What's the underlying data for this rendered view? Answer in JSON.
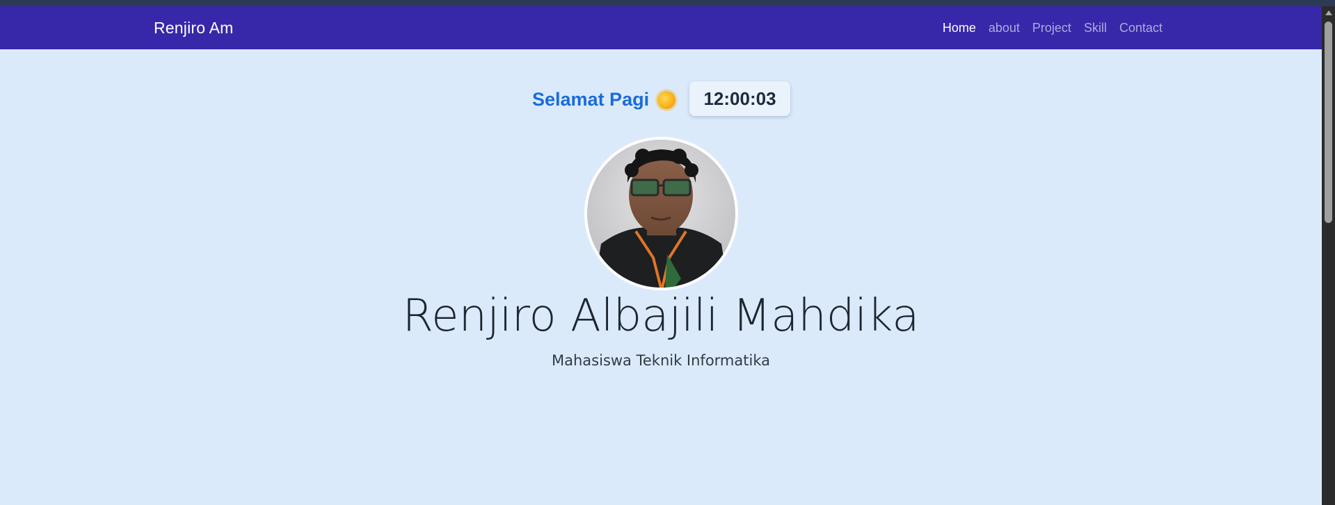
{
  "navbar": {
    "brand": "Renjiro Am",
    "links": [
      {
        "label": "Home"
      },
      {
        "label": "about"
      },
      {
        "label": "Project"
      },
      {
        "label": "Skill"
      },
      {
        "label": "Contact"
      }
    ]
  },
  "hero": {
    "greeting": "Selamat Pagi",
    "greeting_icon": "sun-icon",
    "clock_time": "12:00:03",
    "name": "Renjiro Albajili Mahdika",
    "subtitle": "Mahasiswa Teknik Informatika"
  },
  "colors": {
    "navbar_bg": "#3628a9",
    "page_bg": "#dbeafb",
    "greeting_text": "#1a6bd9"
  }
}
